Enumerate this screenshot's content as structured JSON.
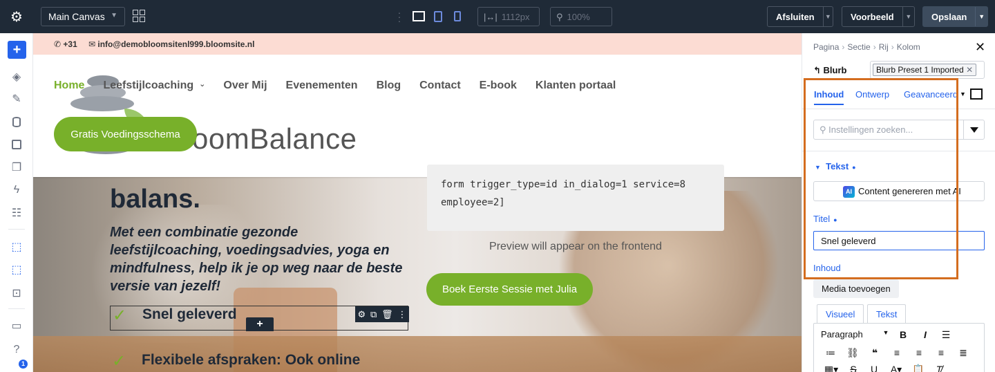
{
  "topbar": {
    "canvas_select": "Main Canvas",
    "width_value": "1112px",
    "zoom_value": "100%",
    "close_label": "Afsluiten",
    "preview_label": "Voorbeeld",
    "save_label": "Opslaan"
  },
  "leftbar": {
    "help_label": "?",
    "notification_count": "1"
  },
  "site": {
    "phone": "+31",
    "email": "info@demobloomsitenl999.bloomsite.nl",
    "nav": [
      "Home",
      "Leefstijlcoaching",
      "Over Mij",
      "Evenementen",
      "Blog",
      "Contact",
      "E-book",
      "Klanten portaal"
    ],
    "logo_text": "oomBalance",
    "cta_label": "Gratis Voedingsschema",
    "heading_fragment": "balans.",
    "subtitle": "Met een combinatie gezonde leefstijlcoaching, voedingsadvies, yoga en mindfulness, help ik je op weg naar de beste versie van jezelf!",
    "code_lines": [
      "form trigger_type=id in_dialog=1 service=8",
      "employee=2]"
    ],
    "preview_text": "Preview will appear on the frontend",
    "book_label": "Boek Eerste Sessie met Julia",
    "blurb1_title": "Snel geleverd",
    "blurb2_title": "Flexibele afspraken: Ook online"
  },
  "panel": {
    "breadcrumbs": [
      "Pagina",
      "Sectie",
      "Rij",
      "Kolom"
    ],
    "module_name": "Blurb",
    "preset": "Blurb Preset 1 Imported",
    "tabs": [
      "Inhoud",
      "Ontwerp",
      "Geavanceerd"
    ],
    "search_placeholder": "Instellingen zoeken...",
    "group_title": "Tekst",
    "ai_badge": "AI",
    "ai_label": "Content genereren met AI",
    "title_label": "Titel",
    "title_value": "Snel geleverd",
    "content_label": "Inhoud",
    "media_label": "Media toevoegen",
    "editor_tabs": [
      "Visueel",
      "Tekst"
    ],
    "paragraph_select": "Paragraph"
  },
  "colors": {
    "accent": "#2563eb",
    "brand_green": "#78b02a",
    "highlight": "#d46d1f",
    "topbar": "#1f2a37"
  }
}
